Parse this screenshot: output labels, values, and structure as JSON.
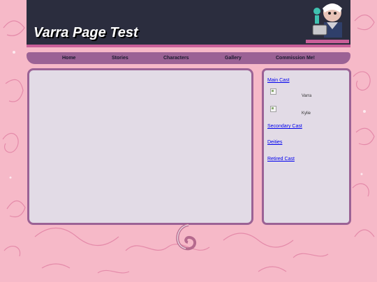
{
  "header": {
    "title": "Varra Page Test"
  },
  "nav": {
    "items": [
      "Home",
      "Stories",
      "Characters",
      "Gallery",
      "Commission Me!"
    ]
  },
  "sidebar": {
    "main_cast_label": "Main Cast",
    "characters": [
      "Varra",
      "Kylie"
    ],
    "secondary_cast_label": "Secondary Cast",
    "deities_label": "Deities",
    "retired_cast_label": "Retired Cast"
  },
  "colors": {
    "background": "#f6b9c8",
    "header": "#2b2d3e",
    "accent": "#9b6295",
    "panel": "#e2dbe6",
    "link": "#0000ee"
  }
}
